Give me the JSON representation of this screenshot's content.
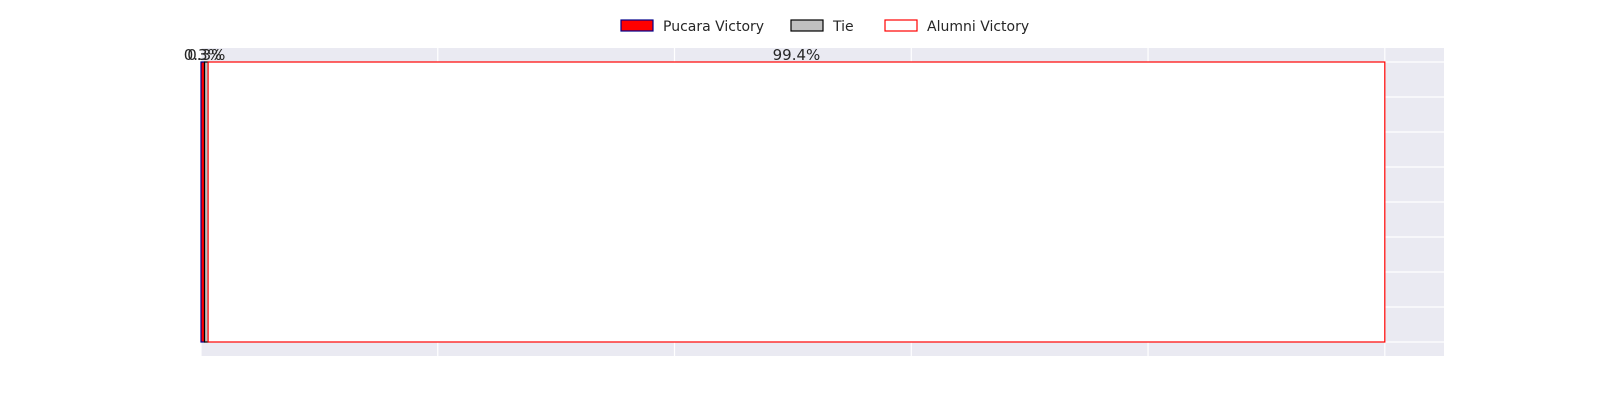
{
  "chart_data": {
    "type": "bar",
    "orientation": "horizontal",
    "stacked": true,
    "grid": true,
    "legend_position": "top-center",
    "xlim": [
      0,
      105
    ],
    "categories": [
      ""
    ],
    "series": [
      {
        "name": "Pucara Victory",
        "values": [
          0.3
        ],
        "label": "0.3%",
        "fill": "#ff0000",
        "edge": "#00008b"
      },
      {
        "name": "Tie",
        "values": [
          0.3
        ],
        "label": "0.3%",
        "fill": "#c0c0c0",
        "edge": "#000000"
      },
      {
        "name": "Alumni Victory",
        "values": [
          99.4
        ],
        "label": "99.4%",
        "fill": "#ffffff",
        "edge": "#ff0000"
      }
    ]
  },
  "colors": {
    "plot_background": "#eaeaf2",
    "grid": "#ffffff",
    "text": "#262626"
  }
}
